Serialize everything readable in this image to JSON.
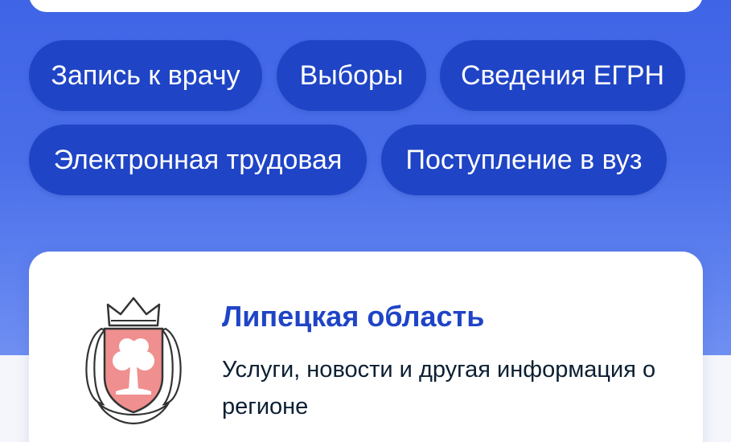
{
  "quick_links": [
    {
      "label": "Запись к врачу"
    },
    {
      "label": "Выборы"
    },
    {
      "label": "Сведения ЕГРН"
    },
    {
      "label": "Электронная трудовая"
    },
    {
      "label": "Поступление в вуз"
    }
  ],
  "region": {
    "title": "Липецкая область",
    "description": "Услуги, новости и другая информация о регионе",
    "emblem_icon": "lipetsk-coat-of-arms-icon"
  },
  "colors": {
    "background_blue": "#4a6ee9",
    "chip": "#1f44c6",
    "title_blue": "#1f44c6",
    "text_dark": "#0b1f33"
  }
}
